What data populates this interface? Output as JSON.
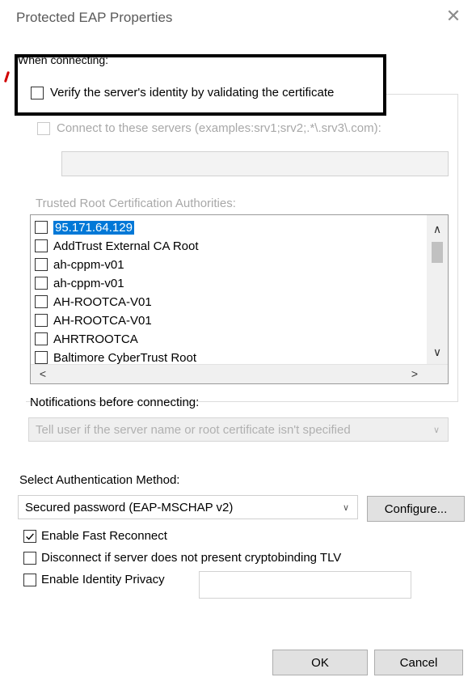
{
  "window": {
    "title": "Protected EAP Properties",
    "close_glyph": "✕"
  },
  "when_connecting": {
    "legend": "When connecting:",
    "verify_checkbox": {
      "label": "Verify the server's identity by validating the certificate",
      "checked": false
    },
    "connect_servers_checkbox": {
      "label": "Connect to these servers (examples:srv1;srv2;.*\\.srv3\\.com):",
      "checked": false,
      "enabled": false
    },
    "servers_field": {
      "value": "",
      "enabled": false
    },
    "trusted_root_label": "Trusted Root Certification Authorities:",
    "trusted_root_list": [
      {
        "label": "95.171.64.129",
        "selected": true
      },
      {
        "label": "AddTrust External CA Root",
        "selected": false
      },
      {
        "label": "ah-cppm-v01",
        "selected": false
      },
      {
        "label": "ah-cppm-v01",
        "selected": false
      },
      {
        "label": "AH-ROOTCA-V01",
        "selected": false
      },
      {
        "label": "AH-ROOTCA-V01",
        "selected": false
      },
      {
        "label": "AHRTROOTCA",
        "selected": false
      },
      {
        "label": "Baltimore CyberTrust Root",
        "selected": false
      }
    ],
    "scroll_glyphs": {
      "up": "∧",
      "down": "∨",
      "left": "<",
      "right": ">"
    },
    "notifications_label": "Notifications before connecting:",
    "notifications_combo": {
      "value": "Tell user if the server name or root certificate isn't specified",
      "enabled": false,
      "glyph": "∨"
    }
  },
  "authentication": {
    "label": "Select Authentication Method:",
    "method_combo": {
      "value": "Secured password (EAP-MSCHAP v2)",
      "glyph": "∨"
    },
    "configure_button": "Configure..."
  },
  "options": {
    "fast_reconnect": {
      "label": "Enable Fast Reconnect",
      "checked": true
    },
    "cryptobinding": {
      "label": "Disconnect if server does not present cryptobinding TLV",
      "checked": false
    },
    "identity_privacy": {
      "label": "Enable Identity Privacy",
      "checked": false,
      "field_value": ""
    }
  },
  "footer": {
    "ok_button": "OK",
    "cancel_button": "Cancel"
  },
  "colors": {
    "selection": "#0078d7",
    "highlight_box": "#000000",
    "disabled_text": "#a8a8a8"
  }
}
